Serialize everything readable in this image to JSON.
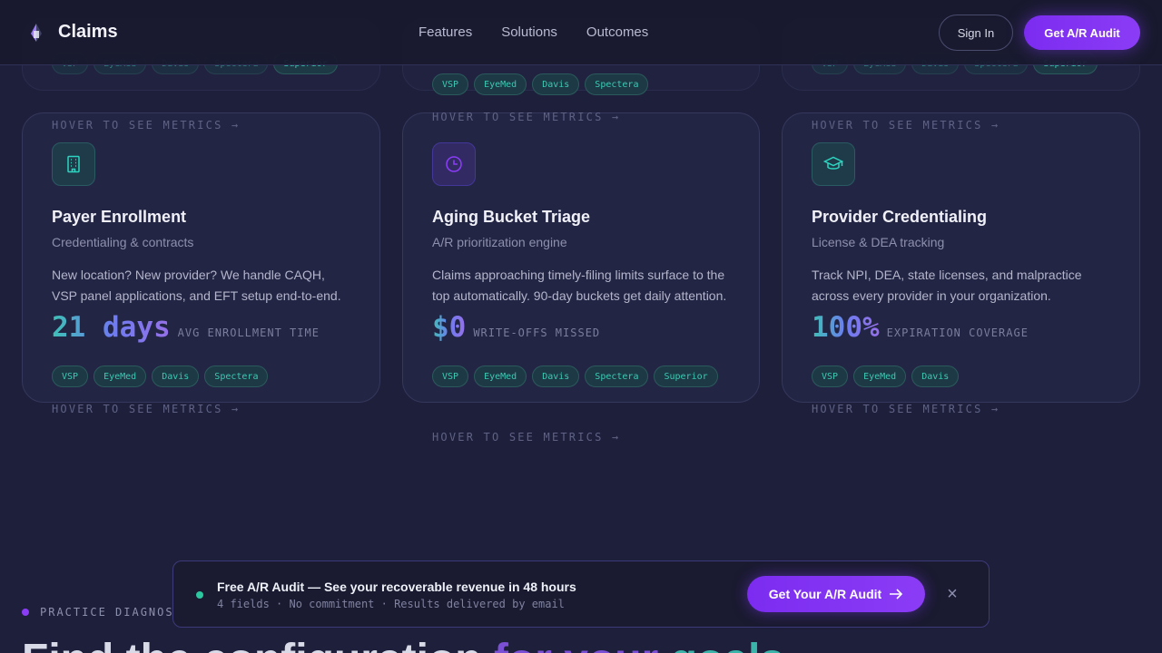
{
  "nav": {
    "brand": "Claims",
    "links": [
      "Features",
      "Solutions",
      "Outcomes"
    ],
    "sign_in": "Sign In",
    "cta": "Get A/R Audit"
  },
  "ghost_cards": [
    {
      "tags_top": [
        "VSP",
        "EyeMed",
        "Davis",
        "Spectera"
      ],
      "tags_bottom": [
        "Superior"
      ],
      "hint": "HOVER TO SEE METRICS →"
    },
    {
      "tags": [
        "VSP",
        "EyeMed",
        "Davis",
        "Spectera"
      ],
      "hint": "HOVER TO SEE METRICS →"
    },
    {
      "tags_top": [
        "VSP",
        "EyeMed",
        "Davis",
        "Spectera"
      ],
      "tags_bottom": [
        "Superior"
      ],
      "hint": "HOVER TO SEE METRICS →"
    }
  ],
  "cards": [
    {
      "icon": "building-icon",
      "title": "Payer Enrollment",
      "subtitle": "Credentialing & contracts",
      "description": "New location? New provider? We handle CAQH, VSP panel applications, and EFT setup end-to-end.",
      "metric_value": "21 days",
      "metric_label": "AVG ENROLLMENT TIME",
      "tags": [
        "VSP",
        "EyeMed",
        "Davis",
        "Spectera"
      ],
      "hint_top": "HOVER TO SEE METRICS →",
      "hint_bottom": "HOVER TO SEE METRICS →"
    },
    {
      "icon": "clock-icon",
      "title": "Aging Bucket Triage",
      "subtitle": "A/R prioritization engine",
      "description": "Claims approaching timely-filing limits surface to the top automatically. 90-day buckets get daily attention.",
      "metric_value": "$0",
      "metric_label": "WRITE-OFFS MISSED",
      "tags": [
        "VSP",
        "EyeMed",
        "Davis",
        "Spectera",
        "Superior"
      ],
      "hint_top": "HOVER TO SEE METRICS →",
      "hint_bottom": "HOVER TO SEE METRICS →"
    },
    {
      "icon": "graduation-cap-icon",
      "title": "Provider Credentialing",
      "subtitle": "License & DEA tracking",
      "description": "Track NPI, DEA, state licenses, and malpractice across every provider in your organization.",
      "metric_value": "100%",
      "metric_label": "EXPIRATION COVERAGE",
      "tags": [
        "VSP",
        "EyeMed",
        "Davis"
      ],
      "hint_top": "HOVER TO SEE METRICS →",
      "hint_bottom": "HOVER TO SEE METRICS →"
    }
  ],
  "banner": {
    "title": "Free A/R Audit — See your recoverable revenue in 48 hours",
    "subtitle": "4 fields · No commitment · Results delivered by email",
    "cta": "Get Your A/R Audit",
    "close": "×"
  },
  "section": {
    "eyebrow": "PRACTICE DIAGNOSTIC",
    "title_start": "Find the configuration ",
    "title_accent": "for your ",
    "title_accent2": "goals"
  },
  "colors": {
    "accent": "#7c3aed",
    "teal": "#2dd4bf",
    "background": "#1e1f3b"
  }
}
